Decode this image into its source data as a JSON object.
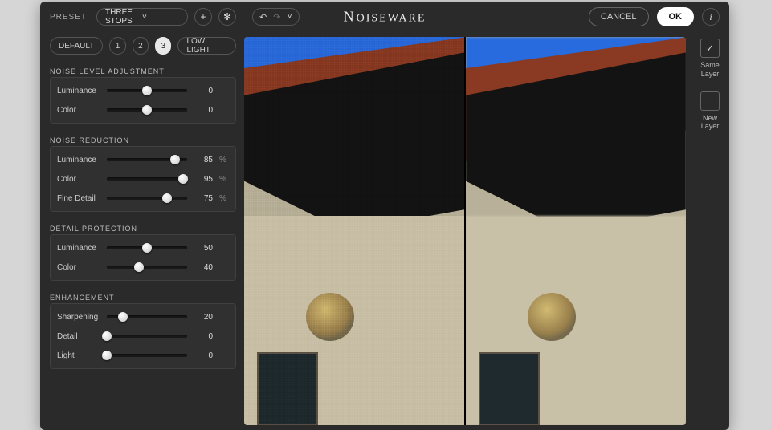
{
  "app_title": "Noiseware",
  "topbar": {
    "preset_label": "PRESET",
    "preset_value": "THREE STOPS",
    "cancel_label": "CANCEL",
    "ok_label": "OK"
  },
  "tabs": {
    "default_label": "DEFAULT",
    "t1": "1",
    "t2": "2",
    "t3": "3",
    "lowlight_label": "LOW LIGHT",
    "active": "3"
  },
  "sections": {
    "noise_level": {
      "title": "NOISE LEVEL ADJUSTMENT",
      "sliders": [
        {
          "label": "Luminance",
          "value": 0,
          "min": -100,
          "max": 100,
          "unit": ""
        },
        {
          "label": "Color",
          "value": 0,
          "min": -100,
          "max": 100,
          "unit": ""
        }
      ]
    },
    "noise_reduction": {
      "title": "NOISE REDUCTION",
      "sliders": [
        {
          "label": "Luminance",
          "value": 85,
          "min": 0,
          "max": 100,
          "unit": "%"
        },
        {
          "label": "Color",
          "value": 95,
          "min": 0,
          "max": 100,
          "unit": "%"
        },
        {
          "label": "Fine Detail",
          "value": 75,
          "min": 0,
          "max": 100,
          "unit": "%"
        }
      ]
    },
    "detail_protection": {
      "title": "DETAIL PROTECTION",
      "sliders": [
        {
          "label": "Luminance",
          "value": 50,
          "min": 0,
          "max": 100,
          "unit": ""
        },
        {
          "label": "Color",
          "value": 40,
          "min": 0,
          "max": 100,
          "unit": ""
        }
      ]
    },
    "enhancement": {
      "title": "ENHANCEMENT",
      "sliders": [
        {
          "label": "Sharpening",
          "value": 20,
          "min": 0,
          "max": 100,
          "unit": ""
        },
        {
          "label": "Detail",
          "value": 0,
          "min": 0,
          "max": 100,
          "unit": ""
        },
        {
          "label": "Light",
          "value": 0,
          "min": 0,
          "max": 100,
          "unit": ""
        }
      ]
    }
  },
  "layers": {
    "same": {
      "label": "Same\nLayer",
      "selected": true
    },
    "new": {
      "label": "New\nLayer",
      "selected": false
    }
  }
}
